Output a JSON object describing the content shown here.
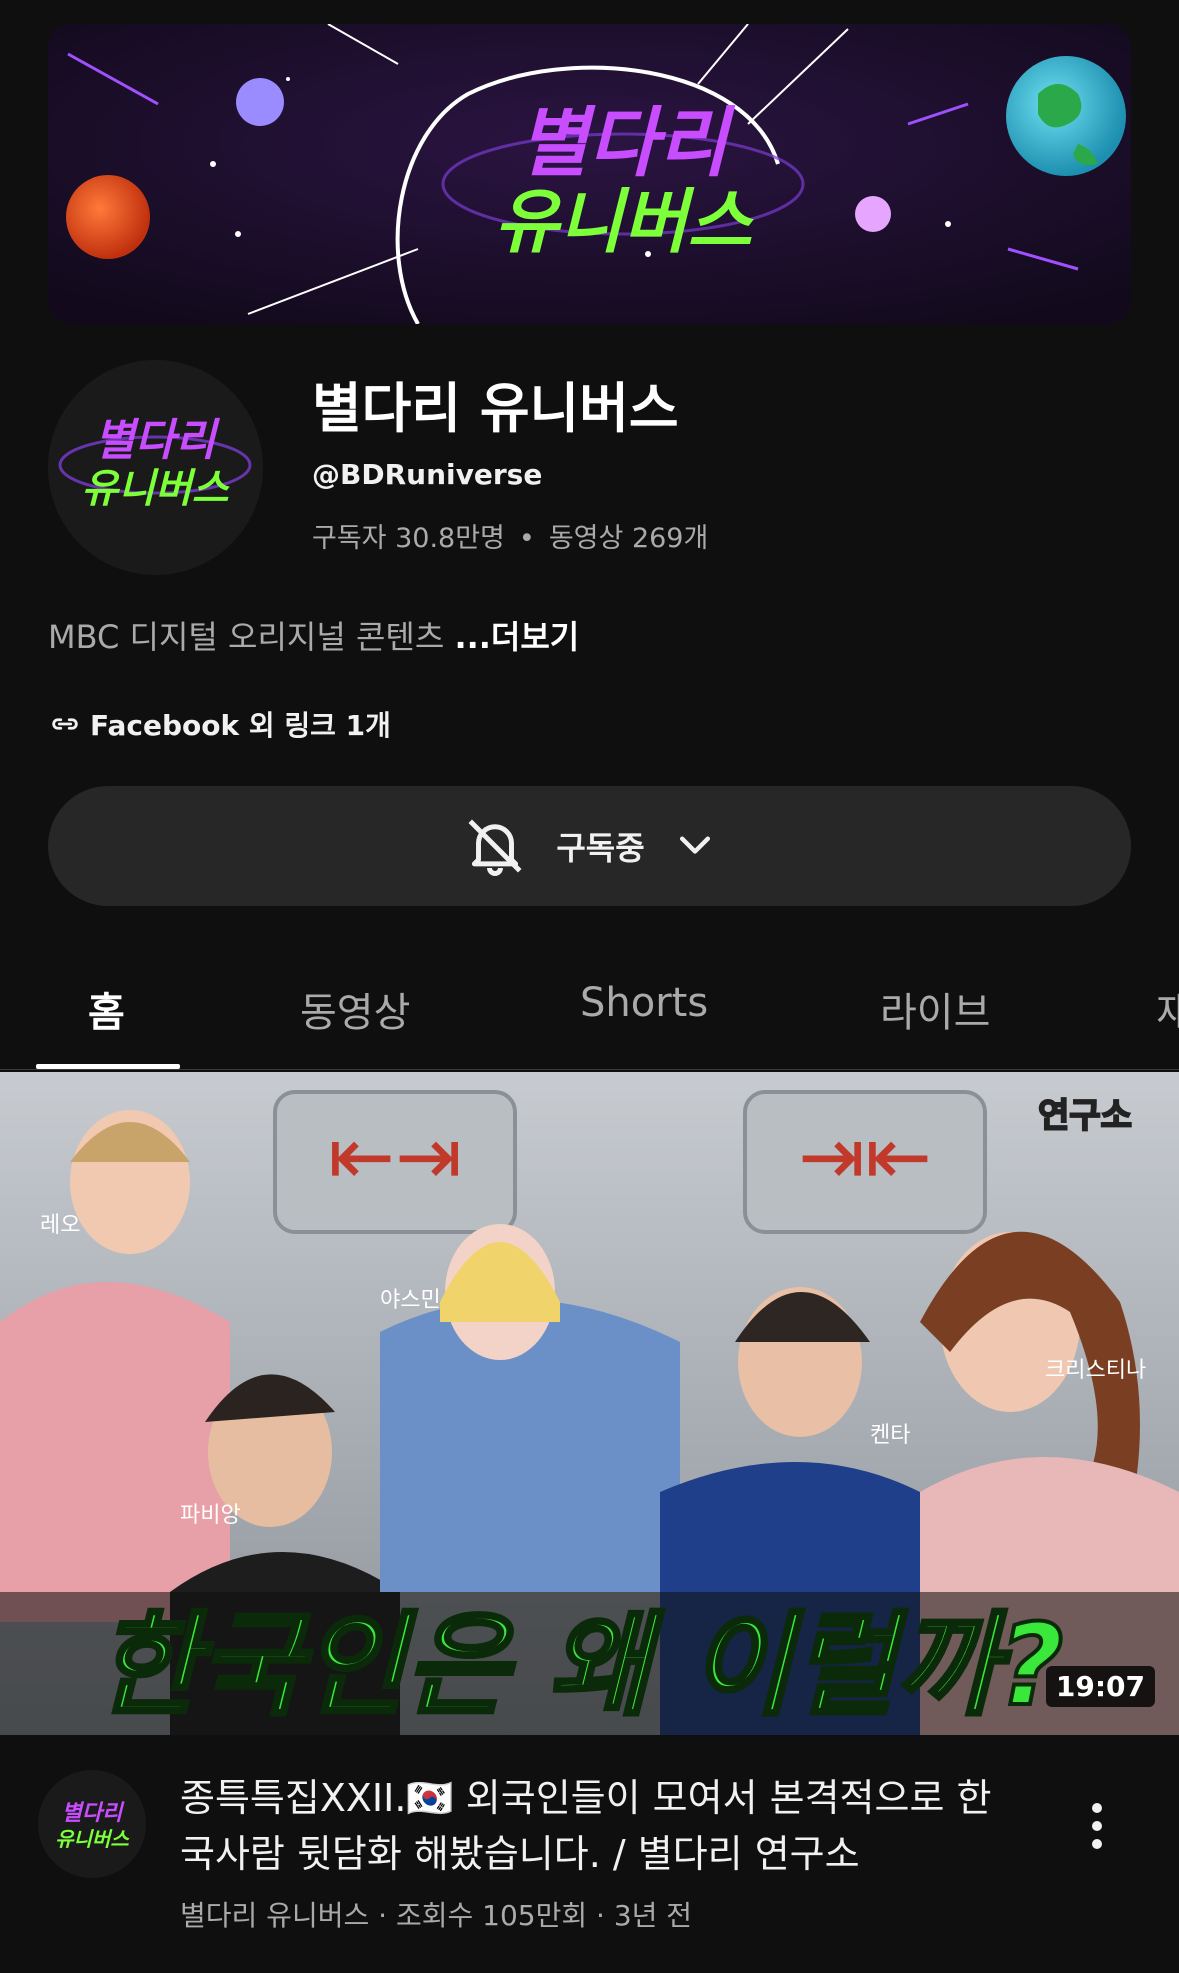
{
  "banner": {
    "logo_line1": "별다리",
    "logo_line2": "유니버스"
  },
  "channel": {
    "name": "별다리 유니버스",
    "handle": "@BDRuniverse",
    "subscribers": "구독자 30.8만명",
    "stats_separator": "•",
    "videos": "동영상 269개",
    "avatar_line1": "별다리",
    "avatar_line2": "유니버스"
  },
  "description": {
    "text": "MBC 디지털 오리지널 콘텐츠 ",
    "more": "...더보기"
  },
  "links": {
    "text": "Facebook 외 링크 1개",
    "icon": "link-icon"
  },
  "subscribe_button": {
    "label": "구독중",
    "icon": "bell-off-icon",
    "chevron": "chevron-down-icon"
  },
  "tabs": [
    {
      "label": "홈",
      "active": true
    },
    {
      "label": "동영상",
      "active": false
    },
    {
      "label": "Shorts",
      "active": false
    },
    {
      "label": "라이브",
      "active": false
    },
    {
      "label": "재",
      "active": false
    }
  ],
  "featured_video": {
    "thumbnail": {
      "corner_badge": "연구소",
      "caption": "한국인은 왜 이럴까?",
      "names": [
        "레오",
        "야스민",
        "파비앙",
        "켄타",
        "크리스티나"
      ]
    },
    "duration": "19:07",
    "title": "종특특집XXII.🇰🇷 외국인들이 모여서 본격적으로 한국사람 뒷담화 해봤습니다. / 별다리 연구소",
    "channel": "별다리 유니버스",
    "views": "조회수 105만회",
    "age": "3년 전",
    "meta_separator": "·"
  },
  "colors": {
    "background": "#0f0f0f",
    "surface": "#272727",
    "text_primary": "#f1f1f1",
    "text_secondary": "#aaaaaa",
    "logo_purple": "#c74dff",
    "logo_green": "#7dff3a",
    "caption_green": "#39e83a"
  }
}
